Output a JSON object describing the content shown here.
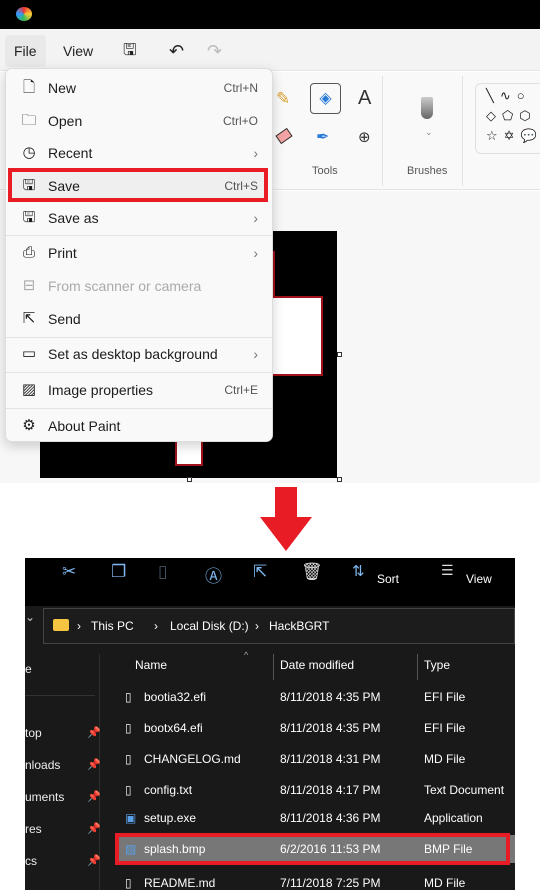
{
  "paint": {
    "menubar": {
      "file": "File",
      "view": "View"
    },
    "ribbon": {
      "tools_label": "Tools",
      "brushes_label": "Brushes"
    },
    "file_menu": [
      {
        "label": "New",
        "shortcut": "Ctrl+N",
        "icon": "new-file-icon"
      },
      {
        "label": "Open",
        "shortcut": "Ctrl+O",
        "icon": "folder-icon"
      },
      {
        "label": "Recent",
        "submenu": true,
        "icon": "clock-icon"
      },
      {
        "label": "Save",
        "shortcut": "Ctrl+S",
        "icon": "save-icon",
        "highlighted": true
      },
      {
        "label": "Save as",
        "submenu": true,
        "icon": "save-as-icon"
      },
      {
        "label": "Print",
        "submenu": true,
        "icon": "printer-icon"
      },
      {
        "label": "From scanner or camera",
        "disabled": true,
        "icon": "scanner-icon"
      },
      {
        "label": "Send",
        "icon": "share-icon"
      },
      {
        "label": "Set as desktop background",
        "submenu": true,
        "icon": "desktop-icon"
      },
      {
        "label": "Image properties",
        "shortcut": "Ctrl+E",
        "icon": "image-properties-icon"
      },
      {
        "label": "About Paint",
        "icon": "gear-icon"
      }
    ]
  },
  "explorer": {
    "toolbar": {
      "sort": "Sort",
      "view": "View"
    },
    "breadcrumb": [
      "This PC",
      "Local Disk (D:)",
      "HackBGRT"
    ],
    "columns": [
      "Name",
      "Date modified",
      "Type"
    ],
    "nav": [
      "e",
      "top",
      "nloads",
      "uments",
      "res",
      "cs"
    ],
    "files": [
      {
        "name": "bootia32.efi",
        "date": "8/11/2018 4:35 PM",
        "type": "EFI File"
      },
      {
        "name": "bootx64.efi",
        "date": "8/11/2018 4:35 PM",
        "type": "EFI File"
      },
      {
        "name": "CHANGELOG.md",
        "date": "8/11/2018 4:31 PM",
        "type": "MD File"
      },
      {
        "name": "config.txt",
        "date": "8/11/2018 4:17 PM",
        "type": "Text Document"
      },
      {
        "name": "setup.exe",
        "date": "8/11/2018 4:36 PM",
        "type": "Application"
      },
      {
        "name": "splash.bmp",
        "date": "6/2/2016 11:53 PM",
        "type": "BMP File",
        "selected": true
      },
      {
        "name": "README.md",
        "date": "7/11/2018 7:25 PM",
        "type": "MD File"
      }
    ]
  },
  "colors": {
    "highlight": "#e81c24"
  }
}
